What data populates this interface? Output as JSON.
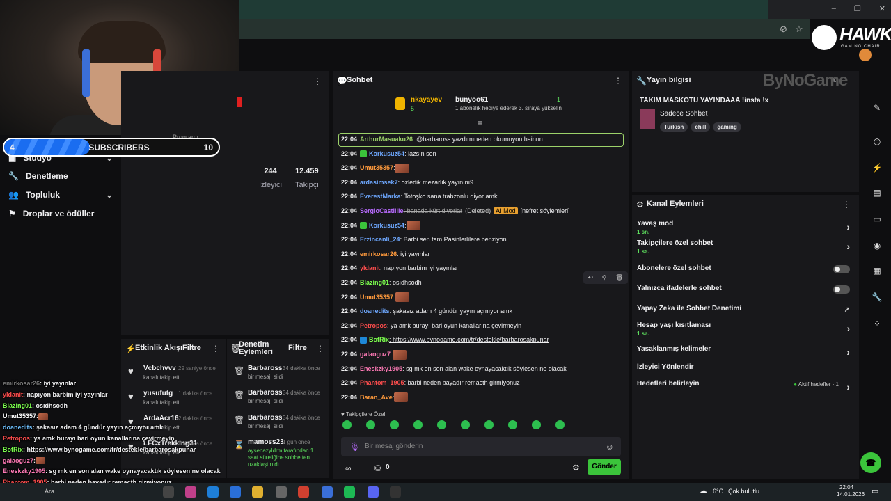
{
  "brand": {
    "logo_text": "HAWK",
    "logo_sub": "GAMING CHAIR",
    "sponsor": "ByNoGame"
  },
  "subscriber_goal": {
    "current": "4",
    "label": "SUBSCRIBERS",
    "goal": "10",
    "progress_fraction": 0.4
  },
  "nav": {
    "items": [
      {
        "label": "Stüdyo"
      },
      {
        "label": "Denetleme"
      },
      {
        "label": "Topluluk"
      },
      {
        "label": "Droplar ve ödüller"
      }
    ],
    "partial_label": "Programı"
  },
  "stats": {
    "viewers_value": "244",
    "viewers_label": "İzleyici",
    "followers_value": "12.459",
    "followers_label": "Takipçi"
  },
  "activity": {
    "title": "Etkinlik Akışı",
    "filter": "Filtre",
    "items": [
      {
        "name": "Vcbchvvv",
        "time": "29 saniye önce",
        "text": "kanalı takip etti"
      },
      {
        "name": "yusufutg",
        "time": "1 dakika önce",
        "text": "kanalı takip etti"
      },
      {
        "name": "ArdaAcr16",
        "time": "2 dakika önce",
        "text": "kanalı takip etti"
      },
      {
        "name": "LFCxTrekking31",
        "time": "7 dakika önce",
        "text": "kanalı takip etti"
      }
    ]
  },
  "moderation": {
    "title": "Denetim Eylemleri",
    "filter": "Filtre",
    "items": [
      {
        "name": "Barbaross",
        "time": "34 dakika önce",
        "text": "bir mesajı sildi"
      },
      {
        "name": "Barbaross",
        "time": "34 dakika önce",
        "text": "bir mesajı sildi"
      },
      {
        "name": "Barbaross",
        "time": "34 dakika önce",
        "text": "bir mesajı sildi"
      },
      {
        "name": "mamoss23",
        "time": "1 gün önce",
        "text": "aysenazyldrm tarafından 1 saat süreliğine sohbetten uzaklaştırıldı"
      }
    ]
  },
  "overlay_chat": [
    {
      "user": "emirkosar26",
      "text": ": iyi yayınlar",
      "color": "#777777"
    },
    {
      "user": "yldanit",
      "text": ": napıyon barbim iyi yayınlar",
      "color": "#ff4d4d"
    },
    {
      "user": "Blazing01",
      "text": ": osıdhsodh",
      "color": "#7cff4d"
    },
    {
      "user": "Umut35357",
      "text": ":",
      "color": "#ffffff"
    },
    {
      "user": "doanedits",
      "text": ": şakasız adam 4 gündür yayın açmıyor amk",
      "color": "#6ec1ff"
    },
    {
      "user": "Petropos",
      "text": ": ya amk burayı bari oyun kanallarına çevirmeyin",
      "color": "#ff4d4d"
    },
    {
      "user": "BotRix",
      "text": ": https://www.bynogame.com/tr/destekle/barbarosakpunar",
      "color": "#7cff4d"
    },
    {
      "user": "galaoguz7",
      "text": ":",
      "color": "#ff7ab6"
    },
    {
      "user": "Eneskzky1905",
      "text": ": sg mk en son alan wake oynayacaktık söylesen ne olacak",
      "color": "#ff7ab6"
    },
    {
      "user": "Phantom_1905",
      "text": ": barbi neden bayadır remacth girmiyonuz",
      "color": "#ff4d4d"
    },
    {
      "user": "Baran_Ave",
      "text": ":",
      "color": "#ff9a3c"
    }
  ],
  "chat": {
    "title": "Sohbet",
    "pinned_user1": "nkayayev",
    "pinned_count1": "5",
    "pinned_user2": "bunyoo61",
    "pinned_count2": "1",
    "pinned_text": "1 abonelik hediye ederek 3. sıraya yükselin",
    "messages": [
      {
        "time": "22:04",
        "user": "ArthurMasuaku26",
        "text": ": @barbaross yazdımıneden okumuyon hainnn",
        "color": "#9cd26a"
      },
      {
        "time": "22:04",
        "user": "Korkusuz54",
        "text": ": lazsın sen",
        "color": "#6ea8ff"
      },
      {
        "time": "22:04",
        "user": "Umut35357",
        "text": ":",
        "color": "#ff9a3c"
      },
      {
        "time": "22:04",
        "user": "ardasimsek7",
        "text": ": ozledik mezarlık yayınını9",
        "color": "#6ea8ff"
      },
      {
        "time": "22:04",
        "user": "EverestMarka",
        "text": ": Totoşko sana trabzonlu diyor amk",
        "color": "#6ea8ff"
      },
      {
        "time": "22:04",
        "user": "SergioCastillle",
        "text": ": banada kürt diyorlar",
        "color": "#b86bff",
        "extra": "(Deleted)",
        "mod": "AI Mod",
        "reason": "[nefret söylemleri]"
      },
      {
        "time": "22:04",
        "user": "Korkusuz54",
        "text": ":",
        "color": "#6ea8ff"
      },
      {
        "time": "22:04",
        "user": "Erzincanli_24",
        "text": ": Barbi sen tam Pasinlerlilere benziyon",
        "color": "#6ea8ff"
      },
      {
        "time": "22:04",
        "user": "emirkosar26",
        "text": ": iyi yayınlar",
        "color": "#ff9a3c"
      },
      {
        "time": "22:04",
        "user": "yldanit",
        "text": ": napıyon barbim iyi yayınlar",
        "color": "#ff4d4d"
      },
      {
        "time": "22:04",
        "user": "Blazing01",
        "text": ": osıdhsodh",
        "color": "#7cff4d"
      },
      {
        "time": "22:04",
        "user": "Umut35357",
        "text": ":",
        "color": "#ff9a3c"
      },
      {
        "time": "22:04",
        "user": "doanedits",
        "text": ": şakasız adam 4 gündür yayın açmıyor amk",
        "color": "#6ea8ff"
      },
      {
        "time": "22:04",
        "user": "Petropos",
        "text": ": ya amk burayı bari oyun kanallarına çevirmeyin",
        "color": "#ff4d4d"
      },
      {
        "time": "22:04",
        "user": "BotRix",
        "text": ": https://www.bynogame.com/tr/destekle/barbarosakpunar",
        "color": "#7cff4d"
      },
      {
        "time": "22:04",
        "user": "galaoguz7",
        "text": ":",
        "color": "#ff7ab6"
      },
      {
        "time": "22:04",
        "user": "Eneskzky1905",
        "text": ": sg mk en son alan wake oynayacaktık söylesen ne olacak",
        "color": "#ff7ab6"
      },
      {
        "time": "22:04",
        "user": "Phantom_1905",
        "text": ": barbi neden bayadır remacth girmiyonuz",
        "color": "#ff4d4d"
      },
      {
        "time": "22:04",
        "user": "Baran_Ave",
        "text": ":",
        "color": "#ff9a3c"
      }
    ],
    "followers_only_label": "Takipçilere Özel",
    "input_placeholder": "Bir mesaj gönderin",
    "points": "0",
    "send_label": "Gönder"
  },
  "stream_info": {
    "title": "Yayın bilgisi",
    "stream_title": "TAKIM MASKOTU YAYINDAAA !insta !x",
    "category": "Sadece Sohbet",
    "tags": [
      "Turkish",
      "chill",
      "gaming"
    ]
  },
  "channel_actions": {
    "title": "Kanal Eylemleri",
    "rows": [
      {
        "label": "Yavaş mod",
        "sub": "1 sn.",
        "kind": "arrow"
      },
      {
        "label": "Takipçilere özel sohbet",
        "sub": "1 sa.",
        "kind": "arrow"
      },
      {
        "label": "Abonelere özel sohbet",
        "sub": "",
        "kind": "toggle"
      },
      {
        "label": "Yalnızca ifadelerle sohbet",
        "sub": "",
        "kind": "toggle"
      },
      {
        "label": "Yapay Zeka ile Sohbet Denetimi",
        "sub": "",
        "kind": "ext"
      },
      {
        "label": "Hesap yaşı kısıtlaması",
        "sub": "1 sa.",
        "kind": "arrow"
      },
      {
        "label": "Yasaklanmış kelimeler",
        "sub": "",
        "kind": "arrow"
      },
      {
        "label": "İzleyici Yönlendir",
        "sub": "",
        "kind": "none"
      },
      {
        "label": "Hedefleri belirleyin",
        "sub": "",
        "kind": "arrow",
        "status": "Aktif hedefler - 1"
      }
    ]
  },
  "taskbar": {
    "weather_temp": "6°C",
    "weather_text": "Çok bulutlu",
    "time": "22:04",
    "date": "14.01.2026",
    "search_text": "Ara"
  }
}
